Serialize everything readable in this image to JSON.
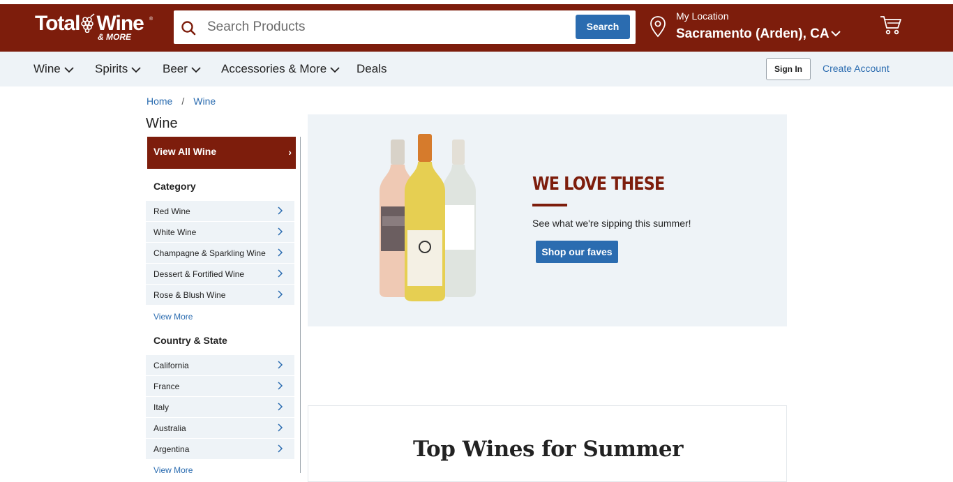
{
  "header": {
    "logo_main": "Total",
    "logo_wine": "Wine",
    "logo_sub": "& MORE",
    "search_placeholder": "Search Products",
    "search_button": "Search",
    "location_label": "My Location",
    "location_value": "Sacramento (Arden), CA"
  },
  "nav": {
    "items": [
      "Wine",
      "Spirits",
      "Beer",
      "Accessories & More",
      "Deals"
    ],
    "sign_in": "Sign In",
    "create_account": "Create Account"
  },
  "breadcrumb": [
    "Home",
    "/",
    "Wine"
  ],
  "page_title": "Wine",
  "sidebar": {
    "view_all": "View All Wine",
    "view_all_arrow": "›",
    "category_title": "Category",
    "categories": [
      "Red Wine",
      "White Wine",
      "Champagne & Sparkling Wine",
      "Dessert & Fortified Wine",
      "Rose & Blush Wine"
    ],
    "category_view_more": "View More",
    "country_title": "Country & State",
    "countries": [
      "California",
      "France",
      "Italy",
      "Australia",
      "Argentina"
    ],
    "country_view_more": "View More"
  },
  "banner": {
    "title": "WE LOVE THESE",
    "subtitle": "See what we're sipping this summer!",
    "button": "Shop our faves"
  },
  "section": {
    "title": "Top Wines for Summer"
  },
  "colors": {
    "brand": "#7d1d0c",
    "accent": "#2b6cb0",
    "nav_bg": "#eef3f7"
  }
}
